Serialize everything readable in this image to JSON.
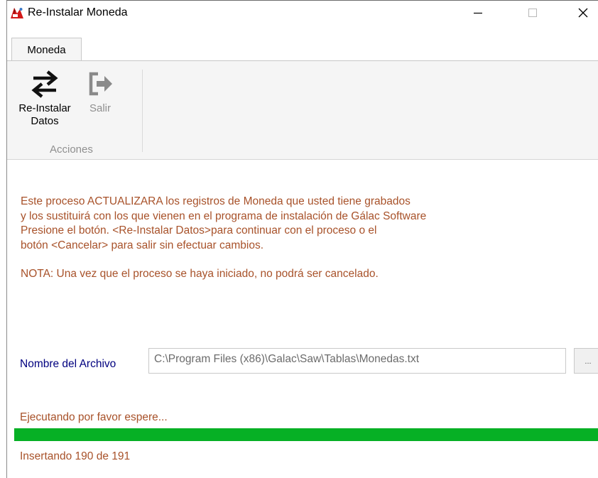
{
  "window": {
    "title": "Re-Instalar Moneda",
    "controls": {
      "minimize_icon": "minimize-icon",
      "maximize_icon": "maximize-icon",
      "close_icon": "close-icon"
    }
  },
  "ribbon": {
    "tab_label": "Moneda",
    "buttons": [
      {
        "label_line1": "Re-Instalar",
        "label_line2": "Datos",
        "icon": "swap-arrows-icon",
        "enabled": true
      },
      {
        "label": "Salir",
        "icon": "exit-icon",
        "enabled": false
      }
    ],
    "group_label": "Acciones"
  },
  "message": {
    "lines": [
      "Este proceso ACTUALIZARA los registros de Moneda que usted tiene grabados",
      "y los sustituirá con los que vienen en el programa de instalación de Gálac Software",
      "Presione el botón.  <Re-Instalar Datos>para continuar con el proceso o el",
      "botón <Cancelar> para salir sin efectuar cambios."
    ],
    "note": "NOTA: Una vez que el proceso se haya iniciado, no podrá ser cancelado."
  },
  "file": {
    "label": "Nombre del Archivo",
    "value": "C:\\Program Files (x86)\\Galac\\Saw\\Tablas\\Monedas.txt",
    "browse_label": "..."
  },
  "progress": {
    "status": "Ejecutando por favor espere...",
    "percent": 100,
    "detail": "Insertando 190 de 191"
  },
  "colors": {
    "message_text": "#a8522a",
    "file_label": "#00007f",
    "progress_fill": "#06b025",
    "disabled_text": "#8f8f8f"
  }
}
